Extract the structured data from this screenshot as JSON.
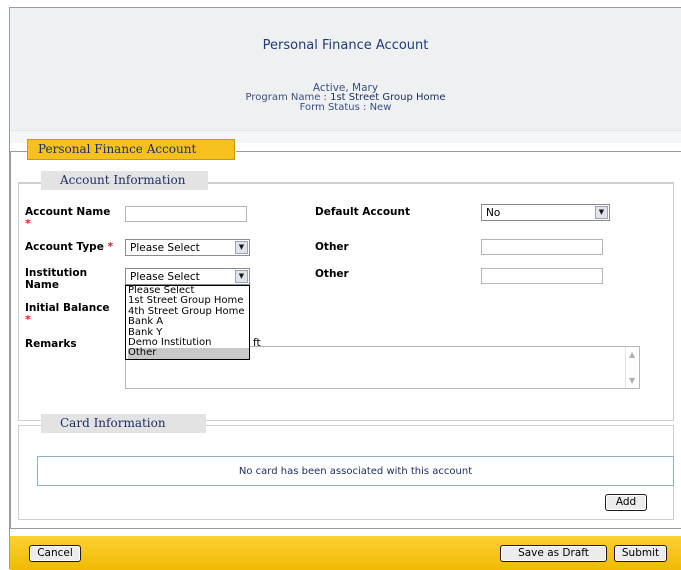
{
  "header": {
    "title": "Personal Finance Account",
    "client_name": "Active, Mary",
    "program_label": "Program Name :",
    "program_value": "1st Street Group Home",
    "status_label": "Form Status :",
    "status_value": "New"
  },
  "section": {
    "title": "Personal Finance Account"
  },
  "account_info": {
    "title": "Account Information",
    "account_name_label": "Account Name",
    "account_name_value": "",
    "account_type_label": "Account Type",
    "account_type_value": "Please Select",
    "institution_label": "Institution Name",
    "institution_value": "Please Select",
    "institution_options": [
      "Please Select",
      "1st Street Group Home",
      "4th Street Group Home",
      "Bank A",
      "Bank Y",
      "Demo Institution",
      "Other"
    ],
    "institution_highlighted": "Other",
    "initial_balance_label": "Initial Balance",
    "remarks_label": "Remarks",
    "partial_text": "ft",
    "default_account_label": "Default Account",
    "default_account_value": "No",
    "other1_label": "Other",
    "other2_label": "Other",
    "required_marker": "*"
  },
  "card_info": {
    "title": "Card Information",
    "empty_message": "No card has been associated with this account",
    "add_label": "Add"
  },
  "footer": {
    "cancel_label": "Cancel",
    "save_draft_label": "Save as Draft",
    "submit_label": "Submit"
  },
  "colors": {
    "accent": "#f6c11f",
    "title_blue": "#1f3b78",
    "required": "#d0201d"
  }
}
